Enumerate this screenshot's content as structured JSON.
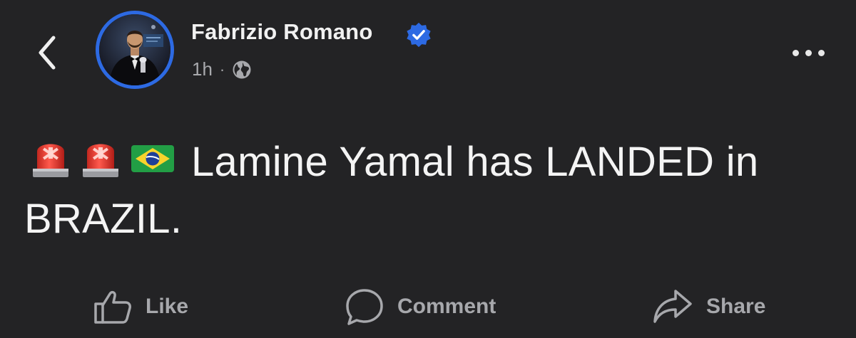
{
  "header": {
    "back_icon": "chevron-left-icon",
    "author_name": "Fabrizio Romano",
    "verified_icon": "verified-badge-icon",
    "time": "1h",
    "separator": "·",
    "audience_icon": "globe-icon",
    "more_icon": "more-horizontal-icon"
  },
  "post": {
    "emojis": [
      "police-light-emoji",
      "police-light-emoji",
      "brazil-flag-emoji"
    ],
    "text": "Lamine Yamal has LANDED in BRAZIL."
  },
  "actions": [
    {
      "label": "Like",
      "icon": "thumbs-up-icon"
    },
    {
      "label": "Comment",
      "icon": "comment-bubble-icon"
    },
    {
      "label": "Share",
      "icon": "share-arrow-icon"
    }
  ],
  "colors": {
    "background": "#232325",
    "accent": "#2d6ae3",
    "text": "#f4f4f4",
    "muted": "#a8a9ad"
  }
}
